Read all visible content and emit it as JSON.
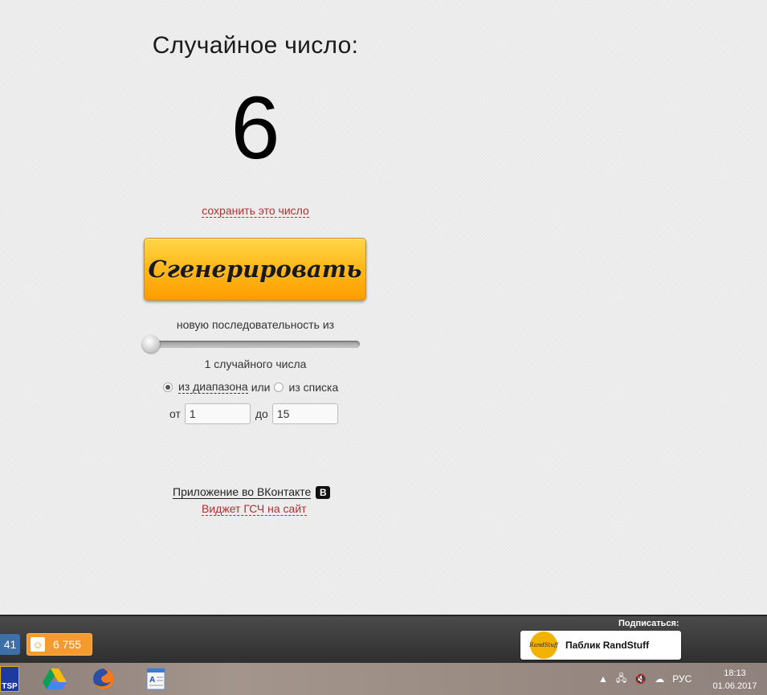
{
  "main": {
    "title": "Случайное число:",
    "number": "6",
    "save_link": "сохранить это число",
    "generate_button": "Сгенерировать",
    "sequence_label": "новую последовательность из",
    "slider_fraction": 0.0,
    "count_label": "1 случайного числа",
    "mode": {
      "range_label": "из диапазона",
      "or_text": "или",
      "list_label": "из списка",
      "selected": "range"
    },
    "range": {
      "from_label": "от",
      "from_value": "1",
      "to_label": "до",
      "to_value": "15"
    },
    "vk_app_link": "Приложение во ВКонтакте",
    "vk_icon": "В",
    "widget_link": "Виджет ГСЧ на сайт"
  },
  "share_bar": {
    "vk_count": "41",
    "ok_count": "6 755",
    "subscribe_label": "Подписаться:",
    "public_name": "Паблик RandStuff",
    "public_logo_text": "RandStuff"
  },
  "taskbar": {
    "tsp_label": "TSP",
    "language": "РУС",
    "time": "18:13",
    "date": "01.06.2017"
  }
}
